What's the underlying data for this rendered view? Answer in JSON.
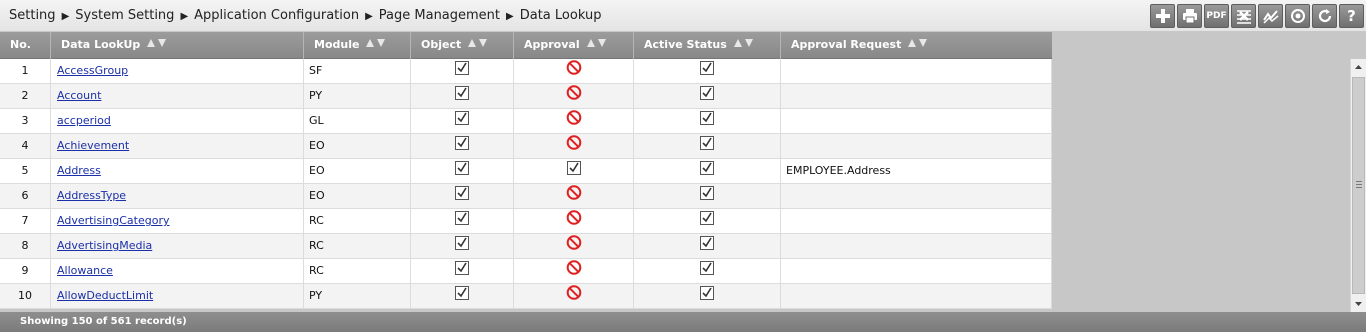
{
  "breadcrumb": [
    "Setting",
    "System Setting",
    "Application Configuration",
    "Page Management",
    "Data Lookup"
  ],
  "toolbar": {
    "buttons": [
      "add-icon",
      "print-icon",
      "pdf-icon",
      "excel-icon",
      "chart-icon",
      "filter-icon",
      "refresh-icon",
      "help-icon"
    ],
    "pdf_label": "PDF",
    "help_label": "?"
  },
  "columns": {
    "no": "No.",
    "name": "Data LookUp",
    "module": "Module",
    "object": "Object",
    "approval": "Approval",
    "active": "Active Status",
    "request": "Approval Request"
  },
  "rows": [
    {
      "no": "1",
      "name": "AccessGroup",
      "module": "SF",
      "object": true,
      "approval": false,
      "active": true,
      "request": ""
    },
    {
      "no": "2",
      "name": "Account",
      "module": "PY",
      "object": true,
      "approval": false,
      "active": true,
      "request": ""
    },
    {
      "no": "3",
      "name": "accperiod",
      "module": "GL",
      "object": true,
      "approval": false,
      "active": true,
      "request": ""
    },
    {
      "no": "4",
      "name": "Achievement",
      "module": "EO",
      "object": true,
      "approval": false,
      "active": true,
      "request": ""
    },
    {
      "no": "5",
      "name": "Address",
      "module": "EO",
      "object": true,
      "approval": true,
      "active": true,
      "request": "EMPLOYEE.Address"
    },
    {
      "no": "6",
      "name": "AddressType",
      "module": "EO",
      "object": true,
      "approval": false,
      "active": true,
      "request": ""
    },
    {
      "no": "7",
      "name": "AdvertisingCategory",
      "module": "RC",
      "object": true,
      "approval": false,
      "active": true,
      "request": ""
    },
    {
      "no": "8",
      "name": "AdvertisingMedia",
      "module": "RC",
      "object": true,
      "approval": false,
      "active": true,
      "request": ""
    },
    {
      "no": "9",
      "name": "Allowance",
      "module": "RC",
      "object": true,
      "approval": false,
      "active": true,
      "request": ""
    },
    {
      "no": "10",
      "name": "AllowDeductLimit",
      "module": "PY",
      "object": true,
      "approval": false,
      "active": true,
      "request": ""
    }
  ],
  "footer": "Showing 150 of 561 record(s)",
  "colors": {
    "link": "#1b2fa8",
    "deny": "#e02020",
    "header": "#8f8f8f"
  }
}
